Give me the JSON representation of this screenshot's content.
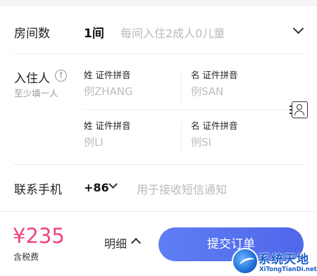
{
  "rooms": {
    "label": "房间数",
    "value": "1间",
    "hint": "每间入住2成人0儿童"
  },
  "guests": {
    "label": "入住人",
    "sub": "至少填一人",
    "info_icon": "!",
    "rows": [
      {
        "surname_label": "姓 证件拼音",
        "surname_placeholder": "例ZHANG",
        "given_label": "名 证件拼音",
        "given_placeholder": "例SAN"
      },
      {
        "surname_label": "姓 证件拼音",
        "surname_placeholder": "例LI",
        "given_label": "名 证件拼音",
        "given_placeholder": "例SI"
      }
    ]
  },
  "phone": {
    "label": "联系手机",
    "code": "+86",
    "hint": "用于接收短信通知"
  },
  "bottom": {
    "price": "¥235",
    "tax": "含税费",
    "detail": "明细",
    "submit": "提交订单"
  },
  "watermark": {
    "title": "系统天地",
    "url": "XiTongTianDi.net"
  },
  "colors": {
    "price": "#f0457a",
    "submit_start": "#5f7ef5",
    "submit_end": "#4f67ea",
    "placeholder": "#bdbdbd"
  },
  "icons": [
    "info-icon",
    "chevron-down-icon",
    "contact-book-icon",
    "chevron-up-icon"
  ]
}
